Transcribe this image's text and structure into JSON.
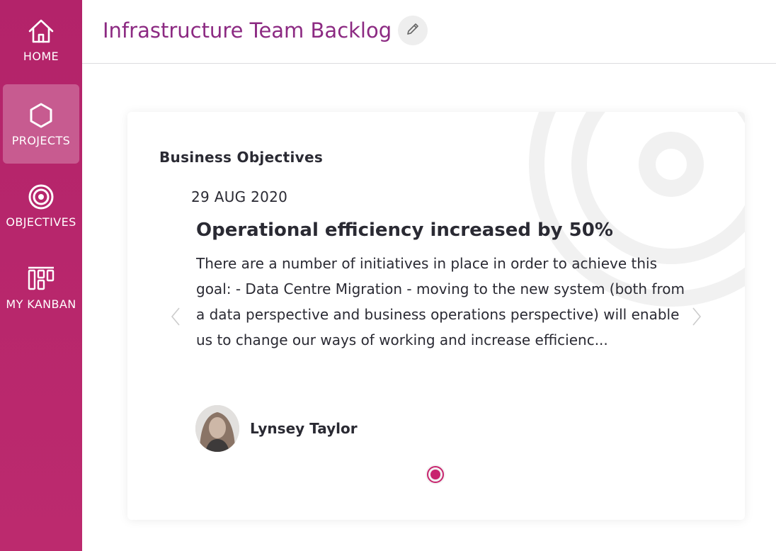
{
  "sidebar": {
    "items": [
      {
        "label": "HOME",
        "icon": "home-icon",
        "active": false
      },
      {
        "label": "PROJECTS",
        "icon": "hexagon-icon",
        "active": true
      },
      {
        "label": "OBJECTIVES",
        "icon": "target-icon",
        "active": false
      },
      {
        "label": "MY KANBAN",
        "icon": "kanban-icon",
        "active": false
      }
    ]
  },
  "header": {
    "title": "Infrastructure Team Backlog",
    "edit_icon": "pencil-icon"
  },
  "card": {
    "title": "Business Objectives",
    "objective": {
      "date": "29 AUG 2020",
      "title": "Operational efficiency increased by 50%",
      "description": "There are a number of initiatives in place in order to achieve this goal: - Data Centre Migration - moving to the new system (both from a data perspective and business operations perspective) will enable us to change our ways of working and increase efficienc..."
    },
    "owner": {
      "name": "Lynsey Taylor"
    },
    "carousel": {
      "prev_icon": "chevron-left-icon",
      "next_icon": "chevron-right-icon",
      "active_index": 0,
      "total": 1
    }
  },
  "colors": {
    "brand": "#b3236a",
    "title": "#8c2a82",
    "accent": "#c8246e",
    "text": "#2a2a33"
  }
}
